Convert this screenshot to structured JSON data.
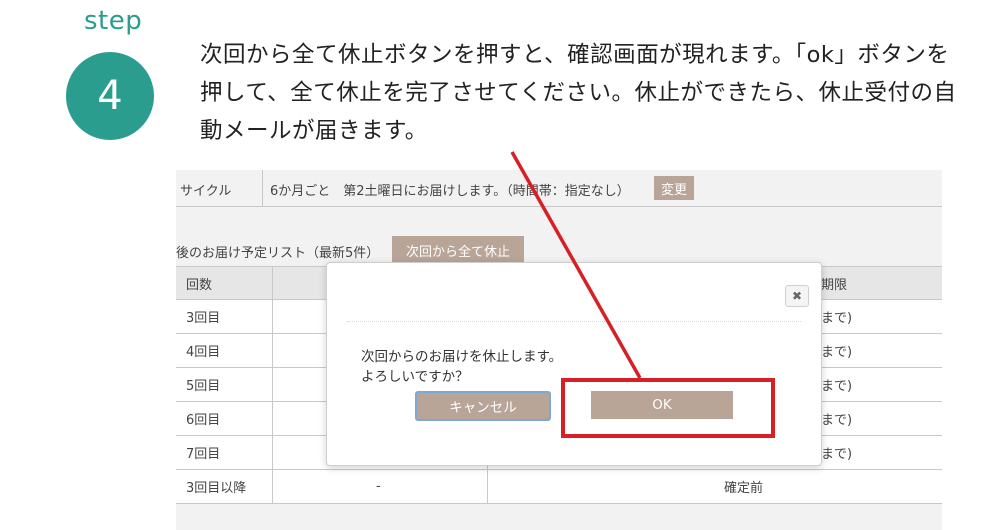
{
  "step": {
    "label": "step",
    "number": "4"
  },
  "instruction": "次回から全て休止ボタンを押すと、確認画面が現れます。「ok」ボタンを押して、全て休止を完了させてください。休止ができたら、休止受付の自動メールが届きます。",
  "screen": {
    "cycle_label": "サイクル",
    "cycle_value": "6か月ごと　第2土曜日にお届けします。（時間帯：指定なし）",
    "change_button": "変更",
    "list_title": "後のお届け予定リスト（最新5件）",
    "stop_all_button": "次回から全て休止",
    "table": {
      "headers": {
        "count": "回数",
        "deadline": "期限"
      },
      "rows": [
        {
          "count": "3回目",
          "deadline": "まで)"
        },
        {
          "count": "4回目",
          "deadline": "まで)"
        },
        {
          "count": "5回目",
          "deadline": "まで)"
        },
        {
          "count": "6回目",
          "deadline": "まで)"
        },
        {
          "count": "7回目",
          "deadline": "まで)"
        }
      ],
      "last_row": {
        "count": "3回目以降",
        "dash": "-",
        "status": "確定前"
      }
    }
  },
  "dialog": {
    "close_icon": "close-icon",
    "message_line1": "次回からのお届けを休止します。",
    "message_line2": "よろしいですか？",
    "cancel_button": "キャンセル",
    "ok_button": "OK"
  },
  "colors": {
    "accent_teal": "#2a9d8f",
    "button_taupe": "#b9a598",
    "highlight_red": "#d81f26"
  }
}
